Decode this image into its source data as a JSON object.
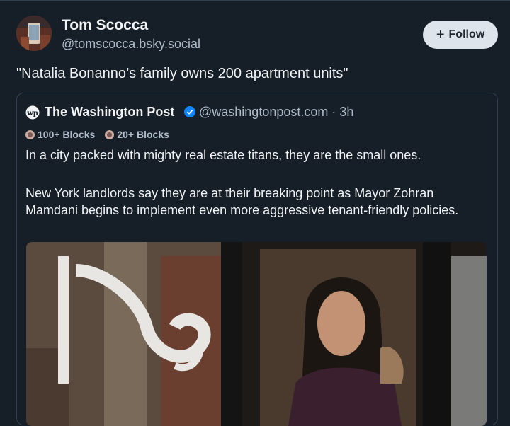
{
  "author": {
    "name": "Tom Scocca",
    "handle": "@tomscocca.bsky.social"
  },
  "follow_button": {
    "label": "Follow"
  },
  "post_text": "\"Natalia Bonanno’s family owns 200 apartment units\"",
  "quoted_post": {
    "author_name": "The Washington Post",
    "handle_time": "@washingtonpost.com · 3h",
    "badges": [
      "100+ Blocks",
      "20+ Blocks"
    ],
    "text_line1": "In a city packed with mighty real estate titans, they are the small ones.",
    "text_line2": "New York landlords say they are at their breaking point as Mayor Zohran Mamdani begins to implement even more aggressive tenant-friendly policies."
  },
  "colors": {
    "background": "#161e27",
    "text": "#f1f3f5",
    "muted": "#aebbc9",
    "border": "#2e4052",
    "follow_bg": "#dde4ec",
    "verified": "#1185fe"
  },
  "icons": [
    "avatar",
    "plus-icon",
    "wp-logo-icon",
    "verified-check-icon",
    "block-badge-icon"
  ]
}
